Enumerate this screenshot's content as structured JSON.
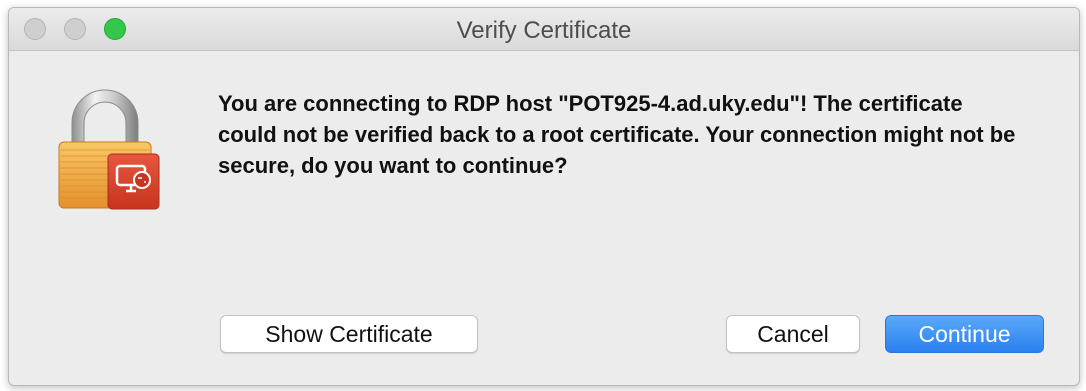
{
  "window": {
    "title": "Verify Certificate"
  },
  "icons": {
    "main": "lock-with-remote-desktop-icon"
  },
  "dialog": {
    "message": "You are connecting to RDP host \"POT925-4.ad.uky.edu\"! The certificate could not be verified back to a root certificate. Your connection might not be secure, do you want to continue?"
  },
  "buttons": {
    "show_certificate": "Show Certificate",
    "cancel": "Cancel",
    "continue": "Continue"
  },
  "colors": {
    "primary_button": "#2a80f0",
    "window_background": "#ececec",
    "zoom_button": "#34c84a",
    "badge": "#d6402f",
    "lock_body": "#f0a63c"
  }
}
